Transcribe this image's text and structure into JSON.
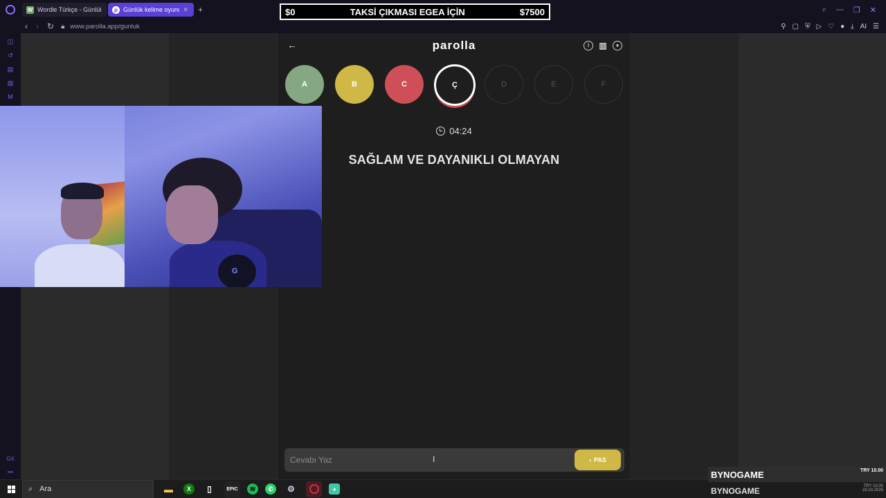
{
  "browser": {
    "tabs": [
      {
        "label": "Wordle Türkçe - Günlük Ke",
        "favicon": "W",
        "active": false
      },
      {
        "label": "Günlük kelime oyunu - par",
        "favicon": "p",
        "active": true
      }
    ],
    "new_tab_icon": "plus-icon",
    "url": "www.parolla.app/gunluk"
  },
  "promo": {
    "left": "$0",
    "title": "TAKSİ ÇIKMASI EGEA İÇİN",
    "right": "$7500"
  },
  "game": {
    "brand": "parolla",
    "letters": [
      {
        "char": "A",
        "state": "correct",
        "color": "#85a882"
      },
      {
        "char": "B",
        "state": "wrong",
        "color": "#cfb845"
      },
      {
        "char": "C",
        "state": "passed",
        "color": "#cf4f59"
      },
      {
        "char": "Ç",
        "state": "current",
        "color": "#1e1e1e"
      },
      {
        "char": "D",
        "state": "pending",
        "color": "#1e1e1e"
      },
      {
        "char": "E",
        "state": "pending",
        "color": "#1e1e1e"
      },
      {
        "char": "F",
        "state": "pending",
        "color": "#1e1e1e"
      }
    ],
    "timer": "04:24",
    "question": "SAĞLAM VE DAYANIKLI OLMAYAN",
    "answer_placeholder": "Cevabı Yaz",
    "pas_label": "PAS"
  },
  "taskbar": {
    "search_label": "Ara"
  },
  "overlay": {
    "byno_name": "BYNOGAME",
    "byno_amount": "TRY 10.00",
    "byno_name_2": "BYNOGAME",
    "tray_amount": "TRY 10.00",
    "date": "23.03.2026"
  }
}
